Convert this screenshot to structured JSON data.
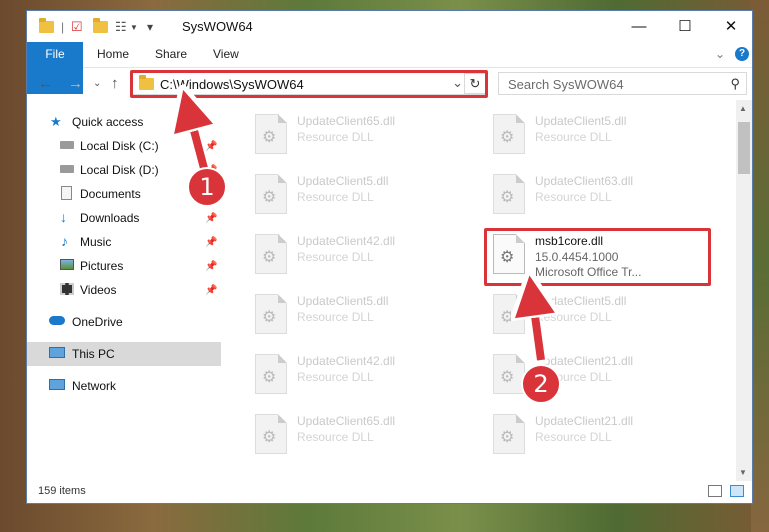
{
  "window": {
    "title": "SysWOW64"
  },
  "titlebar": {
    "minimize_glyph": "—",
    "maximize_glyph": "☐",
    "close_glyph": "✕"
  },
  "ribbon": {
    "tabs": [
      {
        "label": "File"
      },
      {
        "label": "Home"
      },
      {
        "label": "Share"
      },
      {
        "label": "View"
      }
    ],
    "help_glyph": "?",
    "expand_glyph": "⌄"
  },
  "address": {
    "path": "C:\\Windows\\SysWOW64",
    "dropdown_glyph": "⌄",
    "refresh_glyph": "↻"
  },
  "search": {
    "placeholder": "Search SysWOW64",
    "icon": "search-icon"
  },
  "nav": {
    "items": [
      {
        "label": "Quick access",
        "icon": "star-icon"
      },
      {
        "label": "Local Disk (C:)",
        "icon": "drive-icon",
        "pinned": true
      },
      {
        "label": "Local Disk (D:)",
        "icon": "drive-icon",
        "pinned": true
      },
      {
        "label": "Documents",
        "icon": "documents-icon",
        "pinned": true
      },
      {
        "label": "Downloads",
        "icon": "downloads-icon",
        "pinned": true
      },
      {
        "label": "Music",
        "icon": "music-icon",
        "pinned": true
      },
      {
        "label": "Pictures",
        "icon": "pictures-icon",
        "pinned": true
      },
      {
        "label": "Videos",
        "icon": "videos-icon",
        "pinned": true
      },
      {
        "label": "OneDrive",
        "icon": "cloud-icon"
      },
      {
        "label": "This PC",
        "icon": "computer-icon",
        "selected": true
      },
      {
        "label": "Network",
        "icon": "network-icon"
      }
    ]
  },
  "files": {
    "left": [
      {
        "name": "UpdateClient65.dll",
        "desc": "Resource DLL"
      },
      {
        "name": "UpdateClient5.dll",
        "desc": "Resource DLL"
      },
      {
        "name": "UpdateClient42.dll",
        "desc": "Resource DLL"
      },
      {
        "name": "UpdateClient5.dll",
        "desc": "Resource DLL"
      },
      {
        "name": "UpdateClient42.dll",
        "desc": "Resource DLL"
      },
      {
        "name": "UpdateClient65.dll",
        "desc": "Resource DLL"
      }
    ],
    "right": [
      {
        "name": "UpdateClient5.dll",
        "desc": "Resource DLL"
      },
      {
        "name": "UpdateClient63.dll",
        "desc": "Resource DLL"
      },
      {
        "name": "msb1core.dll",
        "desc": "15.0.4454.1000",
        "sub": "Microsoft Office Tr...",
        "active": true
      },
      {
        "name": "UpdateClient5.dll",
        "desc": "Resource DLL"
      },
      {
        "name": "UpdateClient21.dll",
        "desc": "Resource DLL"
      },
      {
        "name": "UpdateClient21.dll",
        "desc": "Resource DLL"
      }
    ]
  },
  "status": {
    "items_count": "159 items"
  },
  "callouts": {
    "one": "1",
    "two": "2"
  },
  "colors": {
    "accent": "#1979ca",
    "highlight": "#d9343a"
  }
}
